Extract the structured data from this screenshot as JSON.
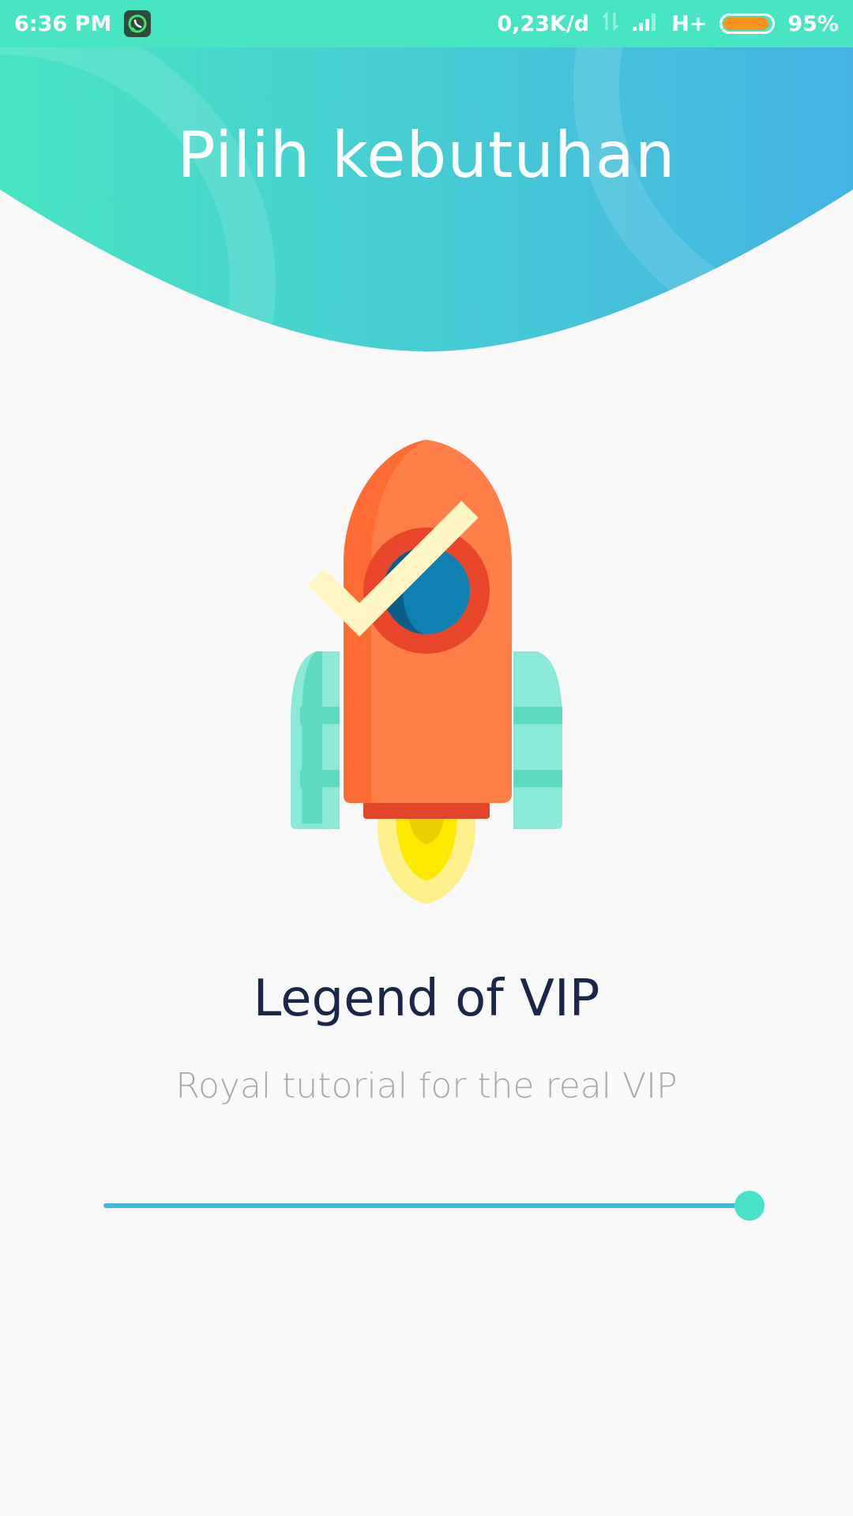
{
  "status_bar": {
    "time": "6:36 PM",
    "notification_icon": "whatsapp-icon",
    "network_speed": "0,23K/d",
    "network_type": "H+",
    "battery_percent_label": "95%",
    "battery_level": 0.95,
    "battery_color": "#f7931e"
  },
  "header": {
    "title": "Pilih kebutuhan",
    "gradient_start": "#47e5c4",
    "gradient_end": "#44b3e3"
  },
  "illustration": {
    "icon": "rocket-checkmark-icon"
  },
  "feature": {
    "title": "Legend of VIP",
    "subtitle": "Royal tutorial for the real VIP"
  },
  "progress": {
    "value_percent": 100
  }
}
